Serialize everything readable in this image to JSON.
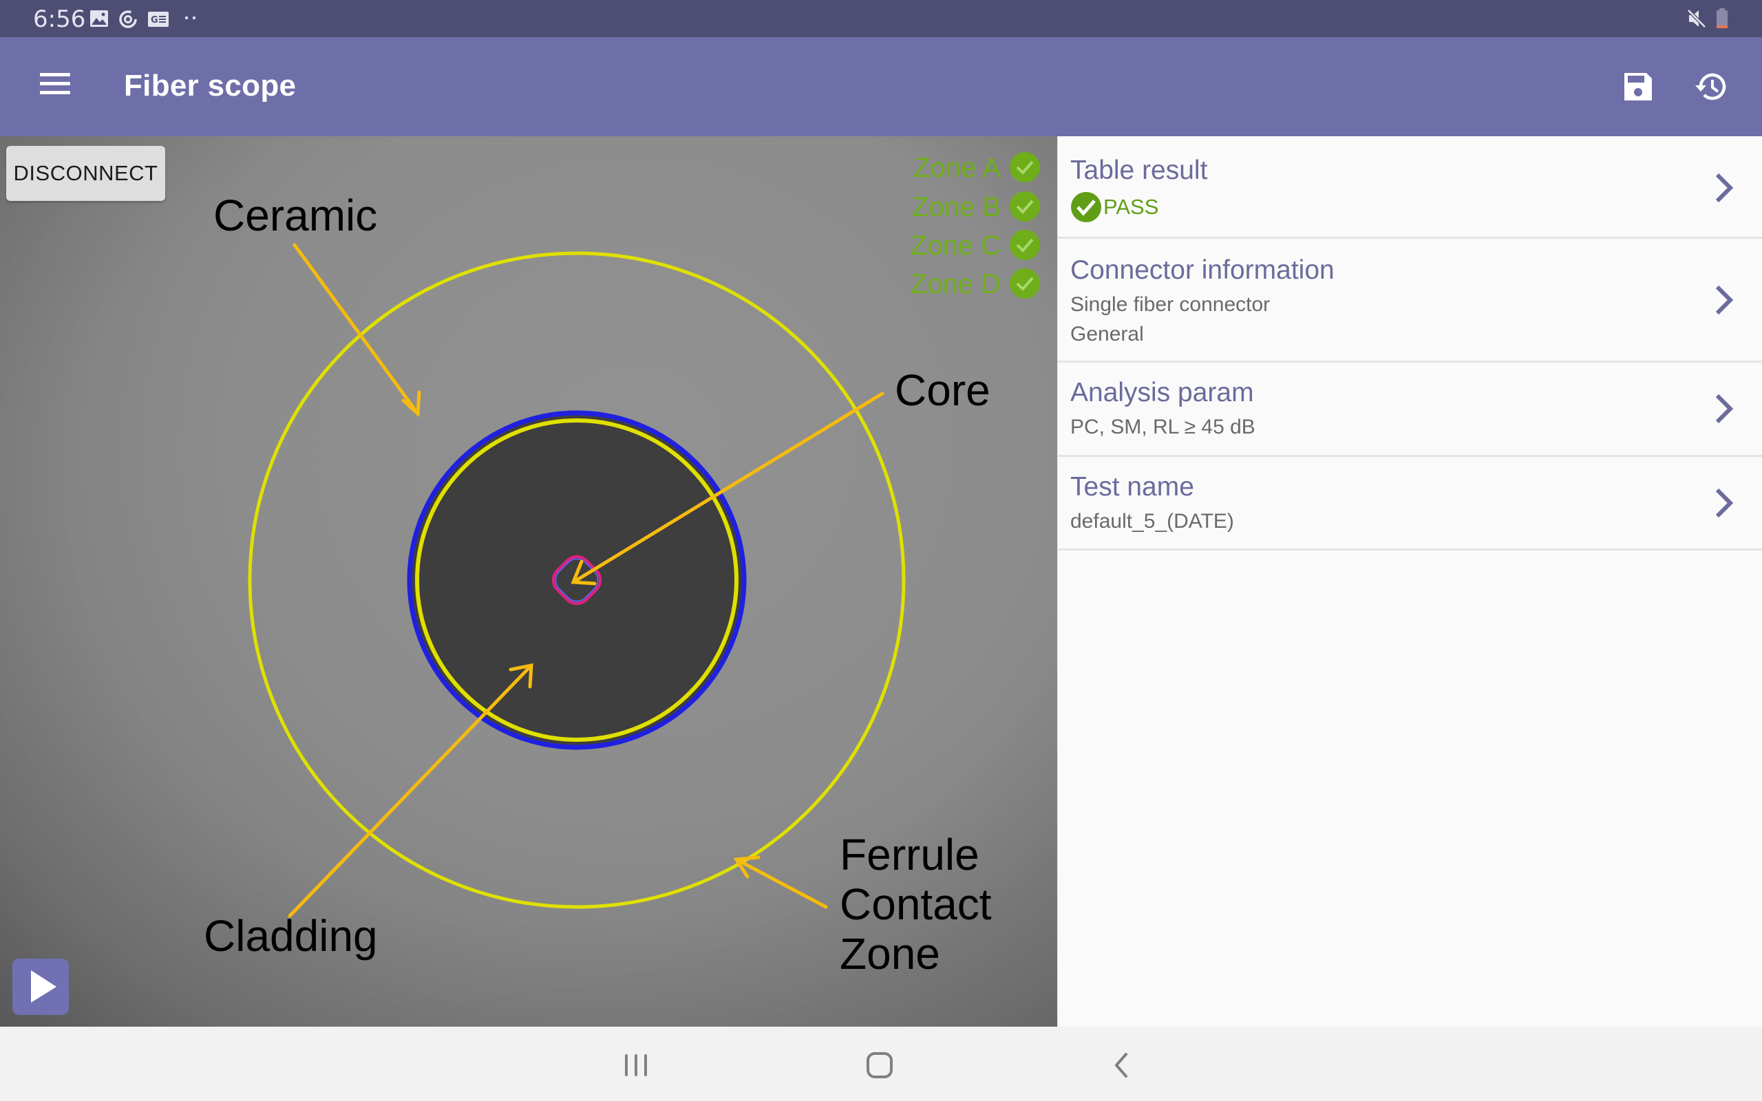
{
  "status_bar": {
    "time": "6:56",
    "icons": [
      "gallery-icon",
      "sync-icon",
      "news-icon",
      "more-dots-icon",
      "mute-icon",
      "battery-low-icon"
    ]
  },
  "app_bar": {
    "title": "Fiber scope",
    "menu_icon": "hamburger-menu-icon",
    "actions": [
      {
        "name": "save",
        "icon": "floppy-save-icon"
      },
      {
        "name": "history",
        "icon": "history-clock-icon"
      }
    ]
  },
  "camera": {
    "disconnect_label": "DISCONNECT",
    "zones": [
      {
        "label": "Zone A",
        "status": "pass"
      },
      {
        "label": "Zone B",
        "status": "pass"
      },
      {
        "label": "Zone C",
        "status": "pass"
      },
      {
        "label": "Zone D",
        "status": "pass"
      }
    ],
    "annotations": {
      "ceramic": "Ceramic",
      "core": "Core",
      "cladding": "Cladding",
      "ferrule": [
        "Ferrule",
        "Contact",
        "Zone"
      ]
    },
    "play_icon": "play-icon"
  },
  "panel": {
    "items": [
      {
        "title": "Table result",
        "result": "PASS"
      },
      {
        "title": "Connector information",
        "lines": [
          "Single fiber connector",
          "General"
        ]
      },
      {
        "title": "Analysis param",
        "lines": [
          "PC, SM, RL ≥ 45 dB"
        ]
      },
      {
        "title": "Test name",
        "lines": [
          "default_5_(DATE)"
        ]
      }
    ]
  },
  "colors": {
    "status_bar": "#4e4e75",
    "app_bar": "#6e6ea8",
    "accent_text": "#6b6b9c",
    "pass_green": "#5f9e16",
    "zone_green": "#6fae1a",
    "ring_yellow": "#e0e000",
    "arrow_gold": "#f6bb0e",
    "cladding_blue": "#2020e0",
    "core_magenta": "#e0207a"
  },
  "nav_bar": {
    "buttons": [
      "recents-icon",
      "home-icon",
      "back-icon"
    ]
  }
}
